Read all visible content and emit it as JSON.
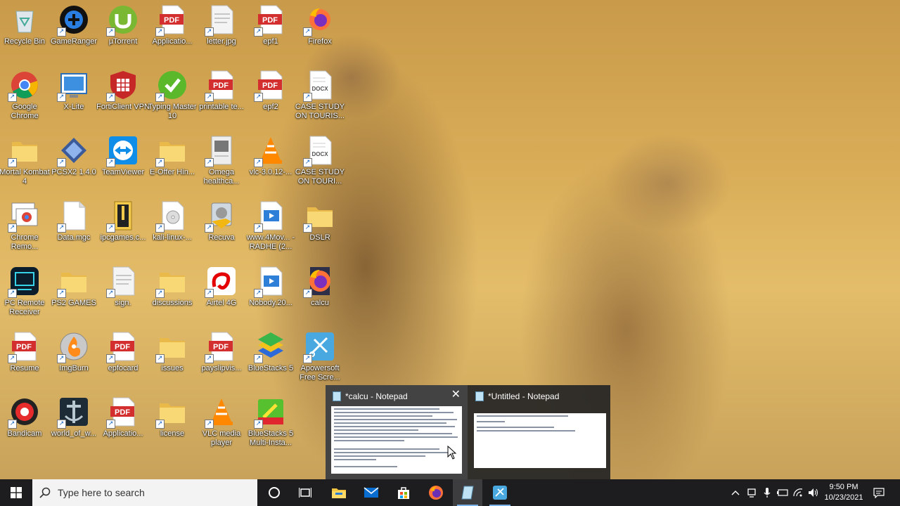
{
  "desktop": {
    "icons": [
      {
        "label": "Recycle Bin",
        "icon": "recycle-bin-icon"
      },
      {
        "label": "GameRanger",
        "icon": "gameranger-icon"
      },
      {
        "label": "µTorrent",
        "icon": "utorrent-icon"
      },
      {
        "label": "Applicatio...",
        "icon": "pdf-icon"
      },
      {
        "label": "letter.jpg",
        "icon": "image-file-icon"
      },
      {
        "label": "epf1",
        "icon": "pdf-icon"
      },
      {
        "label": "Firefox",
        "icon": "firefox-icon"
      },
      {
        "label": "Google Chrome",
        "icon": "chrome-icon"
      },
      {
        "label": "X-Lite",
        "icon": "xlite-icon"
      },
      {
        "label": "FortiClient VPN",
        "icon": "forticlient-icon"
      },
      {
        "label": "Typing Master 10",
        "icon": "typingmaster-icon"
      },
      {
        "label": "printable te...",
        "icon": "pdf-icon"
      },
      {
        "label": "epf2",
        "icon": "pdf-icon"
      },
      {
        "label": "CASE STUDY ON TOURIS...",
        "icon": "docx-icon"
      },
      {
        "label": "Mortal Kombat 4",
        "icon": "folder-icon"
      },
      {
        "label": "PCSX2 1.4.0",
        "icon": "pcsx2-icon"
      },
      {
        "label": "TeamViewer",
        "icon": "teamviewer-icon"
      },
      {
        "label": "E-Offer Hin...",
        "icon": "folder-icon"
      },
      {
        "label": "Omega healthca...",
        "icon": "document-icon"
      },
      {
        "label": "vlc-3.0.12-...",
        "icon": "vlc-icon"
      },
      {
        "label": "CASE STUDY ON TOURI...",
        "icon": "docx-icon"
      },
      {
        "label": "Chrome Remo...",
        "icon": "chrome-remote-icon"
      },
      {
        "label": "Data.mgc",
        "icon": "file-icon"
      },
      {
        "label": "ipcgames.c...",
        "icon": "archive-icon"
      },
      {
        "label": "kali-linux-...",
        "icon": "disc-image-icon"
      },
      {
        "label": "Recuva",
        "icon": "recuva-icon"
      },
      {
        "label": "www.4Mov... - RADHE (2...",
        "icon": "video-file-icon"
      },
      {
        "label": "DSLR",
        "icon": "folder-icon"
      },
      {
        "label": "PC Remote Receiver",
        "icon": "pc-remote-icon"
      },
      {
        "label": "PS2 GAMES",
        "icon": "folder-icon"
      },
      {
        "label": "sign.",
        "icon": "image-file-icon"
      },
      {
        "label": "discussions",
        "icon": "folder-icon"
      },
      {
        "label": "Airtel 4G",
        "icon": "airtel-icon"
      },
      {
        "label": "Nobody.20...",
        "icon": "video-file-icon"
      },
      {
        "label": "calcu",
        "icon": "firefox-html-icon"
      },
      {
        "label": "Resume",
        "icon": "pdf-icon"
      },
      {
        "label": "ImgBurn",
        "icon": "imgburn-icon"
      },
      {
        "label": "epfocard",
        "icon": "pdf-icon"
      },
      {
        "label": "issues",
        "icon": "folder-icon"
      },
      {
        "label": "payslipvis...",
        "icon": "pdf-icon"
      },
      {
        "label": "BlueStacks 5",
        "icon": "bluestacks-icon"
      },
      {
        "label": "Apowersoft Free Scre...",
        "icon": "apowersoft-icon"
      },
      {
        "label": "Bandicam",
        "icon": "bandicam-icon"
      },
      {
        "label": "world_of_w...",
        "icon": "wows-icon"
      },
      {
        "label": "Applicatio...",
        "icon": "pdf-icon"
      },
      {
        "label": "license",
        "icon": "folder-icon"
      },
      {
        "label": "VLC media player",
        "icon": "vlc-icon"
      },
      {
        "label": "BlueStacks 5 Multi-Insta...",
        "icon": "bluestacks-multi-icon"
      }
    ]
  },
  "previews": [
    {
      "title": "*calcu - Notepad",
      "close": "✕"
    },
    {
      "title": "*Untitled - Notepad"
    }
  ],
  "taskbar": {
    "search_placeholder": "Type here to search",
    "time": "9:50 PM",
    "date": "10/23/2021",
    "apps": [
      "file-explorer-icon",
      "mail-icon",
      "store-icon",
      "firefox-icon",
      "notepad-icon",
      "apowersoft-icon"
    ]
  },
  "colors": {
    "taskbar": "#1d1d1f",
    "accent": "#7db3e8",
    "pdf_red": "#d32f2f"
  }
}
